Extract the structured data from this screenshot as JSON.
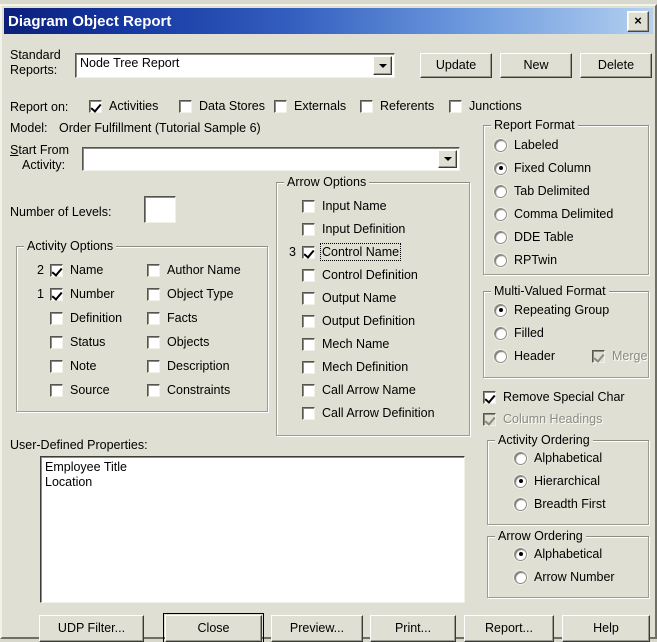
{
  "window": {
    "title": "Diagram Object Report",
    "close_label": "×"
  },
  "standard_reports": {
    "label_line1": "Standard",
    "label_line2": "Reports:",
    "value": "Node Tree Report",
    "buttons": [
      {
        "label": "Update"
      },
      {
        "label": "New"
      },
      {
        "label": "Delete"
      }
    ]
  },
  "report_on": {
    "label": "Report on:",
    "items": [
      {
        "label": "Activities",
        "checked": true
      },
      {
        "label": "Data Stores",
        "checked": false
      },
      {
        "label": "Externals",
        "checked": false
      },
      {
        "label": "Referents",
        "checked": false
      },
      {
        "label": "Junctions",
        "checked": false
      }
    ]
  },
  "model": {
    "label": "Model:",
    "value": "Order Fulfillment (Tutorial Sample 6)"
  },
  "start_from_activity": {
    "label_line1": "Start From",
    "label_line2": "Activity:",
    "value": ""
  },
  "number_of_levels": {
    "label": "Number of Levels:",
    "value": ""
  },
  "activity_options": {
    "title": "Activity Options",
    "left": [
      {
        "label": "Name",
        "checked": true,
        "order": "2"
      },
      {
        "label": "Number",
        "checked": true,
        "order": "1"
      },
      {
        "label": "Definition",
        "checked": false,
        "order": ""
      },
      {
        "label": "Status",
        "checked": false,
        "order": ""
      },
      {
        "label": "Note",
        "checked": false,
        "order": ""
      },
      {
        "label": "Source",
        "checked": false,
        "order": ""
      }
    ],
    "right": [
      {
        "label": "Author Name",
        "checked": false,
        "order": ""
      },
      {
        "label": "Object Type",
        "checked": false,
        "order": ""
      },
      {
        "label": "Facts",
        "checked": false,
        "order": ""
      },
      {
        "label": "Objects",
        "checked": false,
        "order": ""
      },
      {
        "label": "Description",
        "checked": false,
        "order": ""
      },
      {
        "label": "Constraints",
        "checked": false,
        "order": ""
      }
    ]
  },
  "arrow_options": {
    "title": "Arrow Options",
    "items": [
      {
        "label": "Input Name",
        "checked": false,
        "order": "",
        "focused": false
      },
      {
        "label": "Input Definition",
        "checked": false,
        "order": "",
        "focused": false
      },
      {
        "label": "Control Name",
        "checked": true,
        "order": "3",
        "focused": true
      },
      {
        "label": "Control Definition",
        "checked": false,
        "order": "",
        "focused": false
      },
      {
        "label": "Output Name",
        "checked": false,
        "order": "",
        "focused": false
      },
      {
        "label": "Output Definition",
        "checked": false,
        "order": "",
        "focused": false
      },
      {
        "label": "Mech Name",
        "checked": false,
        "order": "",
        "focused": false
      },
      {
        "label": "Mech Definition",
        "checked": false,
        "order": "",
        "focused": false
      },
      {
        "label": "Call Arrow Name",
        "checked": false,
        "order": "",
        "focused": false
      },
      {
        "label": "Call Arrow Definition",
        "checked": false,
        "order": "",
        "focused": false
      }
    ]
  },
  "report_format": {
    "title": "Report Format",
    "options": [
      {
        "label": "Labeled",
        "selected": false
      },
      {
        "label": "Fixed Column",
        "selected": true
      },
      {
        "label": "Tab Delimited",
        "selected": false
      },
      {
        "label": "Comma Delimited",
        "selected": false
      },
      {
        "label": "DDE Table",
        "selected": false
      },
      {
        "label": "RPTwin",
        "selected": false
      }
    ]
  },
  "multi_valued_format": {
    "title": "Multi-Valued Format",
    "options": [
      {
        "label": "Repeating Group",
        "selected": true
      },
      {
        "label": "Filled",
        "selected": false
      },
      {
        "label": "Header",
        "selected": false
      }
    ],
    "merge": {
      "label": "Merge",
      "checked": true,
      "disabled": true
    }
  },
  "flags": [
    {
      "label": "Remove Special Char",
      "checked": true,
      "disabled": false
    },
    {
      "label": "Column Headings",
      "checked": true,
      "disabled": true
    }
  ],
  "activity_ordering": {
    "title": "Activity Ordering",
    "options": [
      {
        "label": "Alphabetical",
        "selected": false
      },
      {
        "label": "Hierarchical",
        "selected": true
      },
      {
        "label": "Breadth First",
        "selected": false
      }
    ]
  },
  "arrow_ordering": {
    "title": "Arrow Ordering",
    "options": [
      {
        "label": "Alphabetical",
        "selected": true
      },
      {
        "label": "Arrow Number",
        "selected": false
      }
    ]
  },
  "user_defined_properties": {
    "label": "User-Defined Properties:",
    "items": [
      "Employee Title",
      "Location"
    ]
  },
  "footer_buttons": [
    {
      "label": "UDP Filter...",
      "default": false
    },
    {
      "label": "Close",
      "default": true
    },
    {
      "label": "Preview...",
      "default": false
    },
    {
      "label": "Print...",
      "default": false
    },
    {
      "label": "Report...",
      "default": false
    },
    {
      "label": "Help",
      "default": false
    }
  ],
  "colors": {
    "dialog_face": "#e0dfd3",
    "title_start": "#0b1f7a",
    "title_end": "#b6d1f0",
    "field_bg": "#ffffff",
    "disabled_text": "#8a8a80"
  }
}
